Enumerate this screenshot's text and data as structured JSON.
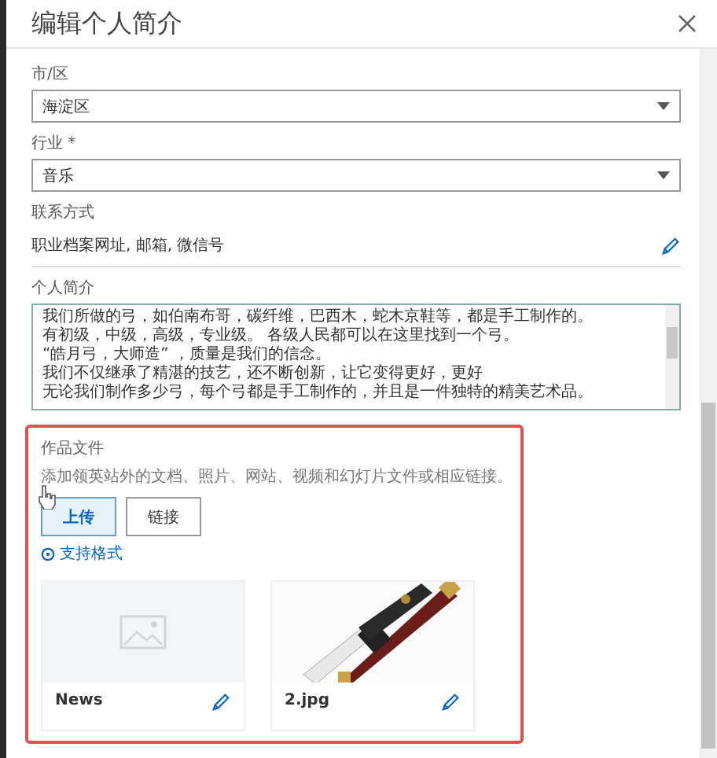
{
  "dialog": {
    "title": "编辑个人简介"
  },
  "fields": [
    {
      "label": "市/区",
      "kind": "select",
      "value": "海淀区"
    },
    {
      "label": "行业 *",
      "kind": "select",
      "value": "音乐"
    },
    {
      "label": "联系方式",
      "kind": "link",
      "value": "职业档案网址, 邮箱, 微信号"
    }
  ],
  "bio": {
    "label": "个人简介",
    "lines": [
      "我们所做的弓，如伯南布哥，碳纤维，巴西木，蛇木京鞋等，都是手工制作的。",
      "有初级，中级，高级，专业级。 各级人民都可以在这里找到一个弓。",
      "“皓月弓，大师造” ，质量是我们的信念。",
      "我们不仅继承了精湛的技艺，还不断创新，让它变得更好，更好",
      "无论我们制作多少弓，每个弓都是手工制作的，并且是一件独特的精美艺术品。"
    ]
  },
  "portfolio": {
    "title": "作品文件",
    "description": "添加领英站外的文档、照片、网站、视频和幻灯片文件或相应链接。",
    "buttons": [
      {
        "label": "上传",
        "selected": true
      },
      {
        "label": "链接",
        "selected": false
      }
    ],
    "help_link": "支持格式",
    "files": [
      {
        "name": "News",
        "kind": "placeholder"
      },
      {
        "name": "2.jpg",
        "kind": "picture"
      }
    ]
  }
}
